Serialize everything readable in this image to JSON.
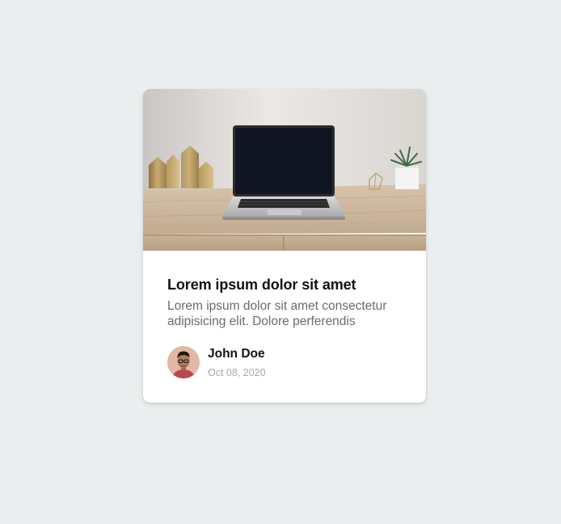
{
  "card": {
    "image_alt": "laptop-on-wooden-desk",
    "title": "Lorem ipsum dolor sit amet",
    "text": "Lorem ipsum dolor sit amet consectetur adipisicing elit. Dolore perferendis",
    "author": {
      "name": "John Doe",
      "date": "Oct 08, 2020"
    }
  },
  "colors": {
    "page_background": "#ebeeef",
    "card_background": "#ffffff",
    "title": "#111111",
    "text": "#6b6b6b",
    "date": "#a8a8a8"
  }
}
